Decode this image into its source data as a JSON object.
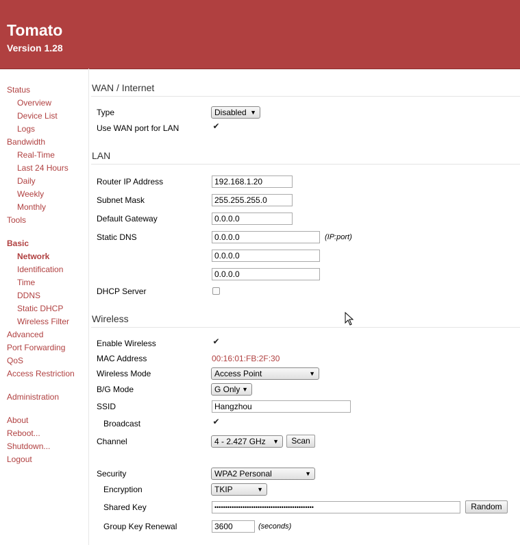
{
  "header": {
    "title": "Tomato",
    "version": "Version 1.28"
  },
  "nav": {
    "status": "Status",
    "overview": "Overview",
    "device_list": "Device List",
    "logs": "Logs",
    "bandwidth": "Bandwidth",
    "realtime": "Real-Time",
    "last24": "Last 24 Hours",
    "daily": "Daily",
    "weekly": "Weekly",
    "monthly": "Monthly",
    "tools": "Tools",
    "basic": "Basic",
    "network": "Network",
    "identification": "Identification",
    "time": "Time",
    "ddns": "DDNS",
    "static_dhcp": "Static DHCP",
    "wireless_filter": "Wireless Filter",
    "advanced": "Advanced",
    "port_forwarding": "Port Forwarding",
    "qos": "QoS",
    "access_restriction": "Access Restriction",
    "administration": "Administration",
    "about": "About",
    "reboot": "Reboot...",
    "shutdown": "Shutdown...",
    "logout": "Logout"
  },
  "wan": {
    "heading": "WAN / Internet",
    "type_label": "Type",
    "type_value": "Disabled",
    "use_wan_label": "Use WAN port for LAN",
    "use_wan_checked": true
  },
  "lan": {
    "heading": "LAN",
    "router_ip_label": "Router IP Address",
    "router_ip": "192.168.1.20",
    "subnet_label": "Subnet Mask",
    "subnet": "255.255.255.0",
    "gateway_label": "Default Gateway",
    "gateway": "0.0.0.0",
    "dns_label": "Static DNS",
    "dns1": "0.0.0.0",
    "dns2": "0.0.0.0",
    "dns3": "0.0.0.0",
    "dns_note": "(IP:port)",
    "dhcp_label": "DHCP Server",
    "dhcp_checked": false
  },
  "wireless": {
    "heading": "Wireless",
    "enable_label": "Enable Wireless",
    "enable_checked": true,
    "mac_label": "MAC Address",
    "mac": "00:16:01:FB:2F:30",
    "mode_label": "Wireless Mode",
    "mode": "Access Point",
    "bg_label": "B/G Mode",
    "bg": "G Only",
    "ssid_label": "SSID",
    "ssid": "Hangzhou",
    "broadcast_label": "Broadcast",
    "broadcast_checked": true,
    "channel_label": "Channel",
    "channel": "4 - 2.427 GHz",
    "scan_label": "Scan",
    "security_label": "Security",
    "security": "WPA2 Personal",
    "encryption_label": "Encryption",
    "encryption": "TKIP",
    "shared_key_label": "Shared Key",
    "shared_key": "••••••••••••••••••••••••••••••••••••••••••••••",
    "random_label": "Random",
    "group_key_label": "Group Key Renewal",
    "group_key": "3600",
    "group_key_note": "(seconds)"
  },
  "colors": {
    "accent": "#b04040",
    "header_bg": "#b04040"
  },
  "icons": {
    "check": "checkmark-icon",
    "dropdown": "triangle-down-icon",
    "cursor": "mouse-pointer-icon"
  }
}
